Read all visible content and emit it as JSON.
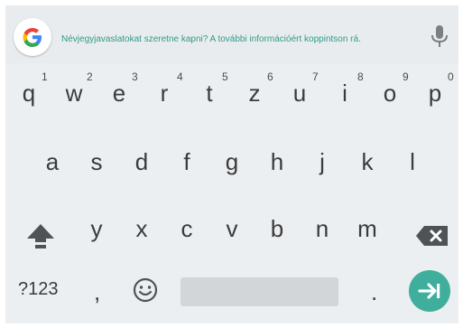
{
  "suggestion_bar": {
    "message": "Névjegyjavaslatokat szeretne kapni? A további információért koppintson rá."
  },
  "rows": {
    "row1": [
      {
        "key": "q",
        "hint": "1"
      },
      {
        "key": "w",
        "hint": "2"
      },
      {
        "key": "e",
        "hint": "3"
      },
      {
        "key": "r",
        "hint": "4"
      },
      {
        "key": "t",
        "hint": "5"
      },
      {
        "key": "z",
        "hint": "6"
      },
      {
        "key": "u",
        "hint": "7"
      },
      {
        "key": "i",
        "hint": "8"
      },
      {
        "key": "o",
        "hint": "9"
      },
      {
        "key": "p",
        "hint": "0"
      }
    ],
    "row2": [
      "a",
      "s",
      "d",
      "f",
      "g",
      "h",
      "j",
      "k",
      "l"
    ],
    "row3": [
      "y",
      "x",
      "c",
      "v",
      "b",
      "n",
      "m"
    ]
  },
  "bottom_row": {
    "symbols_label": "?123",
    "comma": ",",
    "period": "."
  },
  "icons": {
    "logo": "google-g-icon",
    "mic": "microphone-icon",
    "shift": "shift-icon",
    "backspace": "backspace-icon",
    "emoji": "emoji-icon",
    "enter": "enter-arrow-icon"
  },
  "colors": {
    "keyboard_bg": "#eceff1",
    "suggestion_text": "#2f9b86",
    "enter_bg": "#3fae9c",
    "key_text": "#3b3b3b"
  }
}
